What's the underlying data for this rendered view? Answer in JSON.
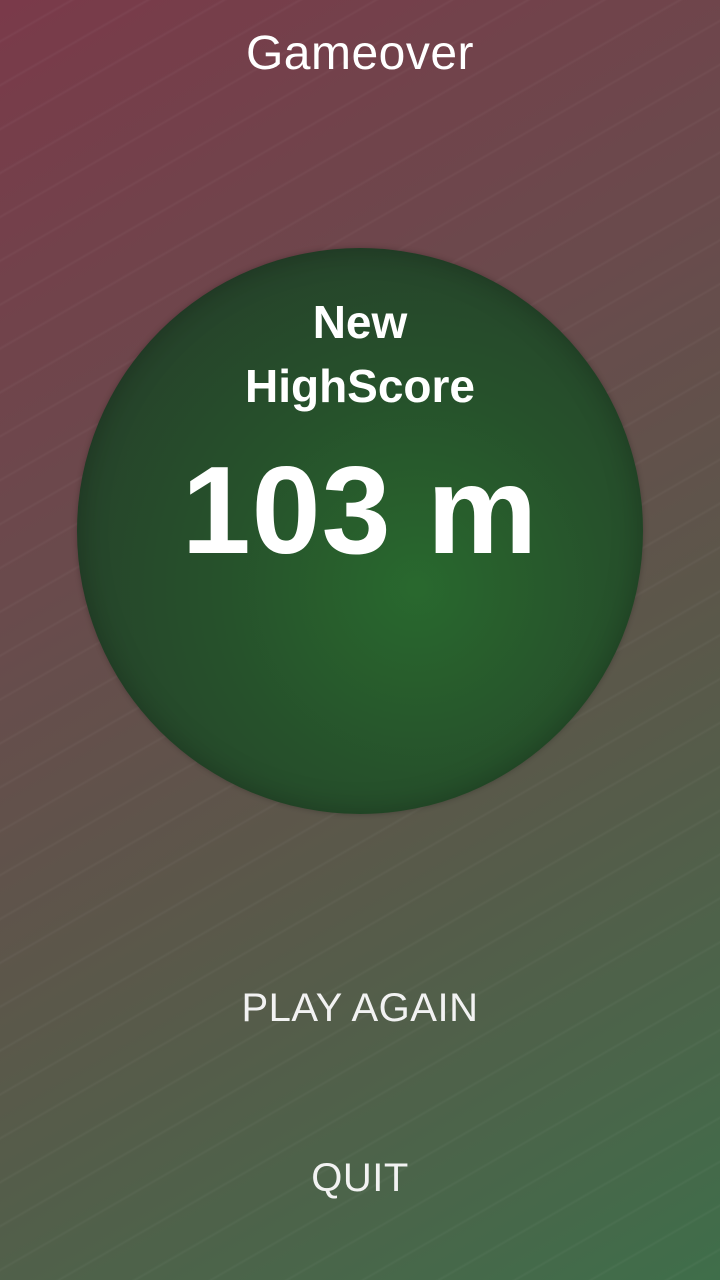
{
  "screen": {
    "title": "Gameover"
  },
  "result": {
    "highscore_line1": "New",
    "highscore_line2": "HighScore",
    "score": "103 m"
  },
  "menu": {
    "play_again_label": "PLAY AGAIN",
    "quit_label": "QUIT"
  },
  "colors": {
    "background_top_left": "#7a3a4a",
    "background_bottom_right": "#3f6e4a",
    "ball": "#2e4a32",
    "text": "#ffffff"
  }
}
